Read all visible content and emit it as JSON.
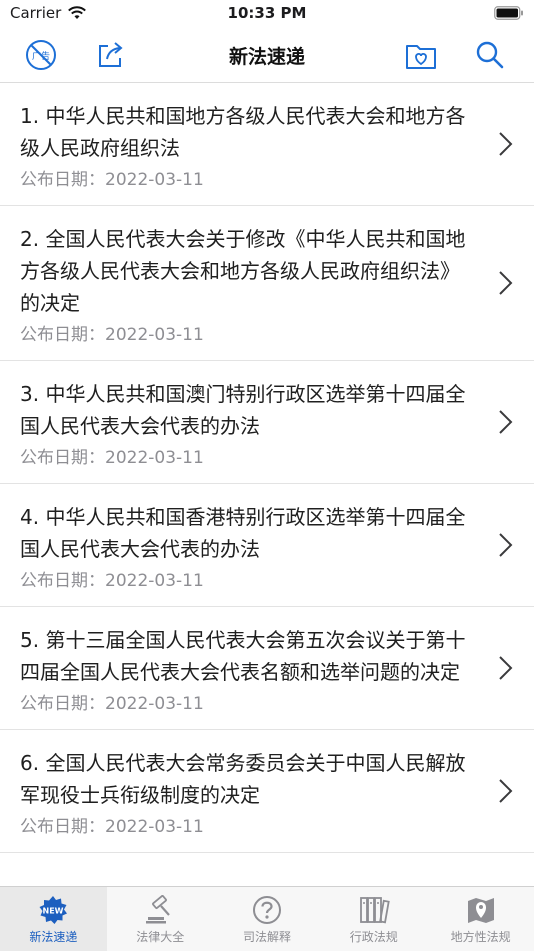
{
  "status_bar": {
    "carrier": "Carrier",
    "time": "10:33 PM"
  },
  "nav": {
    "title": "新法速递",
    "ad_icon_label": "广告",
    "accent": "#1d6fd6"
  },
  "items": [
    {
      "title": "1. 中华人民共和国地方各级人民代表大会和地方各级人民政府组织法",
      "date": "公布日期：2022-03-11"
    },
    {
      "title": "2. 全国人民代表大会关于修改《中华人民共和国地方各级人民代表大会和地方各级人民政府组织法》的决定",
      "date": "公布日期：2022-03-11"
    },
    {
      "title": "3. 中华人民共和国澳门特别行政区选举第十四届全国人民代表大会代表的办法",
      "date": "公布日期：2022-03-11"
    },
    {
      "title": "4. 中华人民共和国香港特别行政区选举第十四届全国人民代表大会代表的办法",
      "date": "公布日期：2022-03-11"
    },
    {
      "title": "5. 第十三届全国人民代表大会第五次会议关于第十四届全国人民代表大会代表名额和选举问题的决定",
      "date": "公布日期：2022-03-11"
    },
    {
      "title": "6. 全国人民代表大会常务委员会关于中国人民解放军现役士兵衔级制度的决定",
      "date": "公布日期：2022-03-11"
    }
  ],
  "tabs": [
    {
      "label": "新法速递",
      "icon": "new-badge-icon"
    },
    {
      "label": "法律大全",
      "icon": "gavel-icon"
    },
    {
      "label": "司法解释",
      "icon": "question-icon"
    },
    {
      "label": "行政法规",
      "icon": "books-icon"
    },
    {
      "label": "地方性法规",
      "icon": "map-pin-icon"
    }
  ]
}
